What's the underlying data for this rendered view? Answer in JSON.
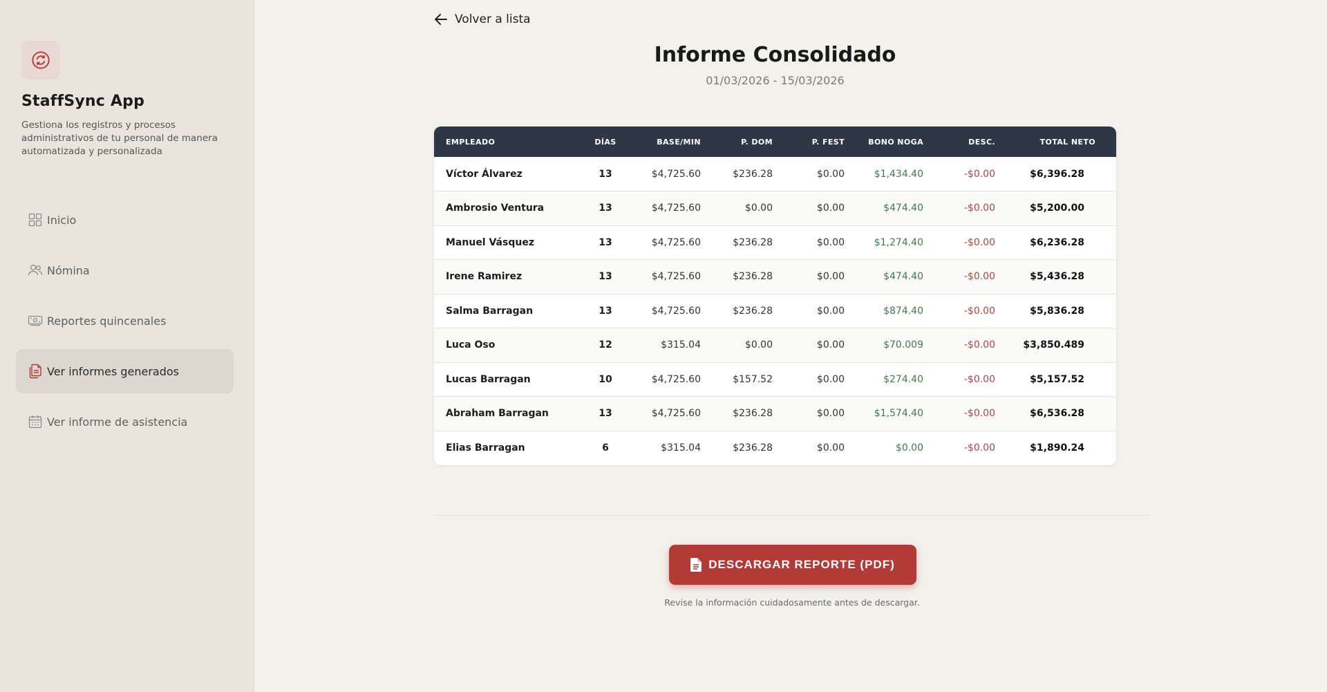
{
  "sidebar": {
    "app_title": "StaffSync App",
    "app_description": "Gestiona los registros y procesos administrativos de tu personal de manera automatizada y personalizada",
    "logo_icon": "sync-icon",
    "accent_color": "#b23b37",
    "items": [
      {
        "label": "Inicio",
        "icon": "grid-icon",
        "active": false
      },
      {
        "label": "Nómina",
        "icon": "users-icon",
        "active": false
      },
      {
        "label": "Reportes quincenales",
        "icon": "money-icon",
        "active": false
      },
      {
        "label": "Ver informes generados",
        "icon": "documents-icon",
        "active": true
      },
      {
        "label": "Ver informe de asistencia",
        "icon": "calendar-icon",
        "active": false
      }
    ]
  },
  "main": {
    "back_label": "Volver a lista",
    "title": "Informe Consolidado",
    "date_range": "01/03/2026 - 15/03/2026",
    "table": {
      "headers": [
        "Empleado",
        "Días",
        "Base/Min",
        "P. Dom",
        "P. Fest",
        "Bono Noga",
        "Desc.",
        "Total Neto"
      ],
      "rows": [
        [
          "Víctor Álvarez",
          "13",
          "$4,725.60",
          "$236.28",
          "$0.00",
          "$1,434.40",
          "-$0.00",
          "$6,396.28"
        ],
        [
          "Ambrosio Ventura",
          "13",
          "$4,725.60",
          "$0.00",
          "$0.00",
          "$474.40",
          "-$0.00",
          "$5,200.00"
        ],
        [
          "Manuel Vásquez",
          "13",
          "$4,725.60",
          "$236.28",
          "$0.00",
          "$1,274.40",
          "-$0.00",
          "$6,236.28"
        ],
        [
          "Irene Ramirez",
          "13",
          "$4,725.60",
          "$236.28",
          "$0.00",
          "$474.40",
          "-$0.00",
          "$5,436.28"
        ],
        [
          "Salma Barragan",
          "13",
          "$4,725.60",
          "$236.28",
          "$0.00",
          "$874.40",
          "-$0.00",
          "$5,836.28"
        ],
        [
          "Luca Oso",
          "12",
          "$315.04",
          "$0.00",
          "$0.00",
          "$70.009",
          "-$0.00",
          "$3,850.489"
        ],
        [
          "Lucas Barragan",
          "10",
          "$4,725.60",
          "$157.52",
          "$0.00",
          "$274.40",
          "-$0.00",
          "$5,157.52"
        ],
        [
          "Abraham Barragan",
          "13",
          "$4,725.60",
          "$236.28",
          "$0.00",
          "$1,574.40",
          "-$0.00",
          "$6,536.28"
        ],
        [
          "Elias Barragan",
          "6",
          "$315.04",
          "$236.28",
          "$0.00",
          "$0.00",
          "-$0.00",
          "$1,890.24"
        ]
      ]
    },
    "download_label": "DESCARGAR REPORTE (PDF)",
    "download_icon": "file-icon",
    "hint": "Revise la información cuidadosamente antes de descargar."
  }
}
